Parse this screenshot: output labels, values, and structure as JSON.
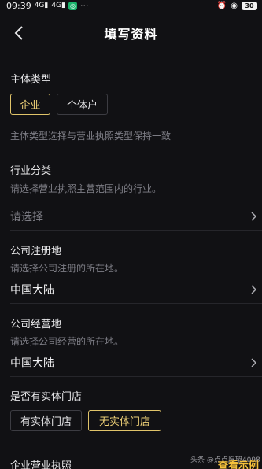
{
  "status_bar": {
    "time": "09:39",
    "signal_1": "4G",
    "signal_2": "4G",
    "more": "···",
    "battery": "30"
  },
  "header": {
    "title": "填写资料"
  },
  "entity_type": {
    "label": "主体类型",
    "options": [
      "企业",
      "个体户"
    ],
    "selected": "企业",
    "hint": "主体类型选择与营业执照类型保持一致"
  },
  "industry": {
    "label": "行业分类",
    "hint": "请选择营业执照主营范围内的行业。",
    "placeholder": "请选择"
  },
  "registered_location": {
    "label": "公司注册地",
    "hint": "请选择公司注册的所在地。",
    "value": "中国大陆"
  },
  "operating_location": {
    "label": "公司经营地",
    "hint": "请选择公司经营的所在地。",
    "value": "中国大陆"
  },
  "physical_store": {
    "label": "是否有实体门店",
    "options": [
      "有实体门店",
      "无实体门店"
    ],
    "selected": "无实体门店"
  },
  "business_license": {
    "label": "企业营业执照"
  },
  "footer": {
    "watermark": "头条 @点点愿望4098",
    "sample_link": "查看示例"
  },
  "colors": {
    "background": "#111114",
    "accent_gold": "#e0c46a",
    "hint_gray": "#7e7e86"
  }
}
